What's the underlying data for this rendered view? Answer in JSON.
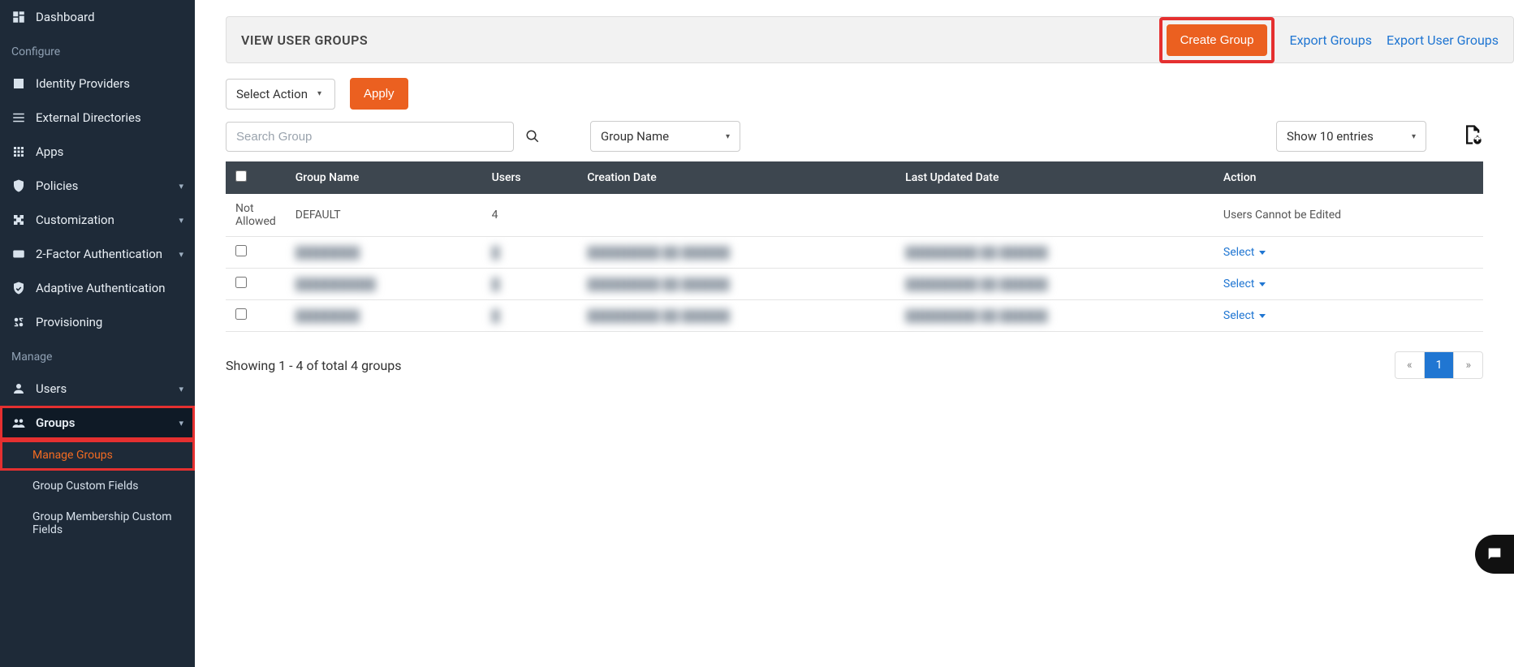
{
  "sidebar": {
    "dashboard": "Dashboard",
    "configure_label": "Configure",
    "identity_providers": "Identity Providers",
    "external_directories": "External Directories",
    "apps": "Apps",
    "policies": "Policies",
    "customization": "Customization",
    "two_factor": "2-Factor Authentication",
    "adaptive_auth": "Adaptive Authentication",
    "provisioning": "Provisioning",
    "manage_label": "Manage",
    "users": "Users",
    "groups": "Groups",
    "manage_groups": "Manage Groups",
    "group_custom_fields": "Group Custom Fields",
    "group_membership_custom_fields": "Group Membership Custom Fields"
  },
  "header": {
    "title": "VIEW USER GROUPS",
    "create_group": "Create Group",
    "export_groups": "Export Groups",
    "export_user_groups": "Export User Groups"
  },
  "controls": {
    "select_action": "Select Action",
    "apply": "Apply",
    "search_placeholder": "Search Group",
    "group_name_filter": "Group Name",
    "show_entries": "Show 10 entries"
  },
  "table": {
    "cols": {
      "group_name": "Group Name",
      "users": "Users",
      "creation_date": "Creation Date",
      "last_updated": "Last Updated Date",
      "action": "Action"
    },
    "rows": [
      {
        "checkbox": false,
        "not_allowed": "Not Allowed",
        "group_name": "DEFAULT",
        "users": "4",
        "creation": "",
        "updated": "",
        "action_text": "Users Cannot be Edited",
        "action_type": "text"
      },
      {
        "checkbox": true,
        "group_name": "████████",
        "users": "█",
        "creation": "█████████ ██ ██████",
        "updated": "█████████ ██ ██████",
        "action_text": "Select",
        "action_type": "select"
      },
      {
        "checkbox": true,
        "group_name": "██████████",
        "users": "█",
        "creation": "█████████ ██ ██████",
        "updated": "█████████ ██ ██████",
        "action_text": "Select",
        "action_type": "select"
      },
      {
        "checkbox": true,
        "group_name": "████████",
        "users": "█",
        "creation": "█████████ ██ ██████",
        "updated": "█████████ ██ ██████",
        "action_text": "Select",
        "action_type": "select"
      }
    ]
  },
  "footer": {
    "showing": "Showing 1 - 4 of total 4 groups",
    "page_prev": "«",
    "page_1": "1",
    "page_next": "»"
  }
}
